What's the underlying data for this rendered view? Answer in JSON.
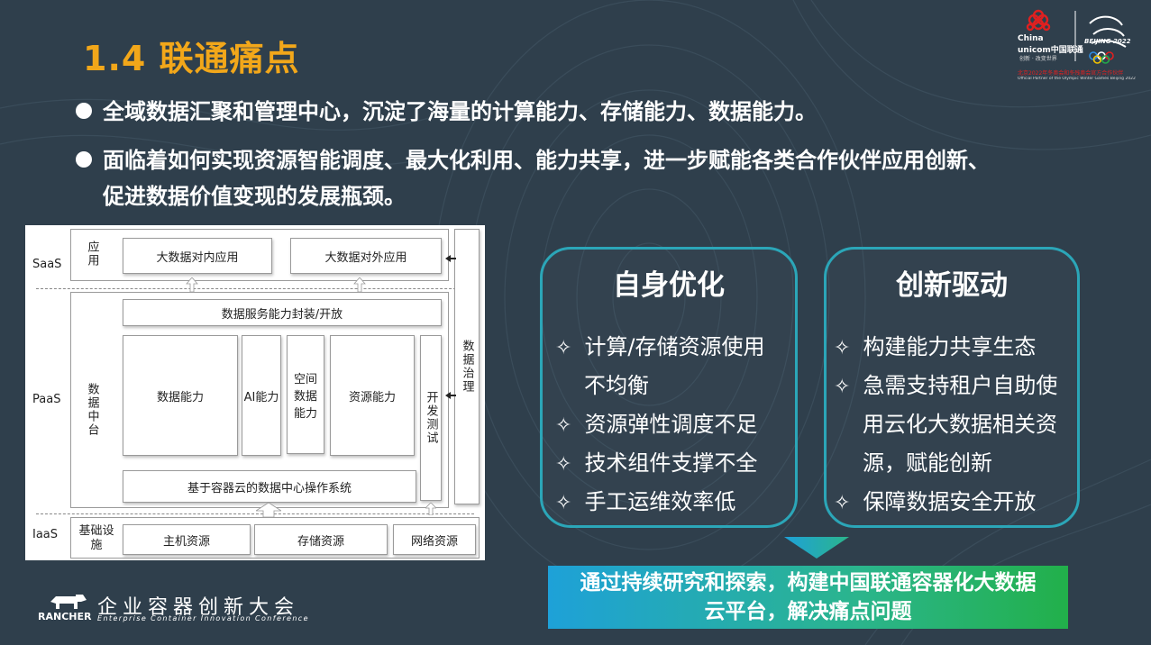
{
  "title": "1.4 联通痛点",
  "bullets": [
    "全域数据汇聚和管理中心，沉淀了海量的计算能力、存储能力、数据能力。",
    "面临着如何实现资源智能调度、最大化利用、能力共享，进一步赋能各类合作伙伴应用创新、",
    "促进数据价值变现的发展瓶颈。"
  ],
  "logo": {
    "unicom_en_1": "China",
    "unicom_en_2": "unicom中国联通",
    "unicom_slogan": "创新 · 改变世界",
    "games_name": "BEIJING 2022",
    "partner_line1": "北京2022年冬奥会和冬残奥会官方合作伙伴",
    "partner_line2": "Official Partner of the Olympic Winter Games Beijing 2022"
  },
  "arch": {
    "layers": {
      "saas": "SaaS",
      "paas": "PaaS",
      "iaas": "IaaS"
    },
    "saas_group": "应用",
    "saas_items": [
      "大数据对内应用",
      "大数据对外应用"
    ],
    "service": "数据服务能力封装/开放",
    "paas_group": "数据中台",
    "capabilities": [
      "数据能力",
      "AI能力",
      "空间数据能力",
      "资源能力"
    ],
    "dev_test": "开发测试",
    "governance": "数据治理",
    "os": "基于容器云的数据中心操作系统",
    "iaas_group": "基础设施",
    "iaas_items": [
      "主机资源",
      "存储资源",
      "网络资源"
    ]
  },
  "cards": [
    {
      "title": "自身优化",
      "items": [
        "计算/存储资源使用",
        "不均衡",
        "资源弹性调度不足",
        "技术组件支撑不全",
        "手工运维效率低"
      ]
    },
    {
      "title": "创新驱动",
      "items": [
        "构建能力共享生态",
        "急需支持租户自助使",
        "用云化大数据相关资",
        "源，赋能创新",
        "保障数据安全开放"
      ]
    }
  ],
  "banner": {
    "line1": "通过持续研究和探索，构建中国联通容器化大数据",
    "line2": "云平台，解决痛点问题"
  },
  "footer": {
    "brand": "RANCHER",
    "conf_cn": "企业容器创新大会",
    "conf_en": "Enterprise Container Innovation Conference"
  },
  "colors": {
    "title": "#f2a71a",
    "card_border": "#2ba6b8",
    "background": "#2f3f4c"
  },
  "icons": [
    "bullet-dot-icon",
    "star-outline-icon",
    "down-arrow-icon",
    "china-unicom-logo",
    "beijing-2022-logo",
    "rancher-logo"
  ]
}
